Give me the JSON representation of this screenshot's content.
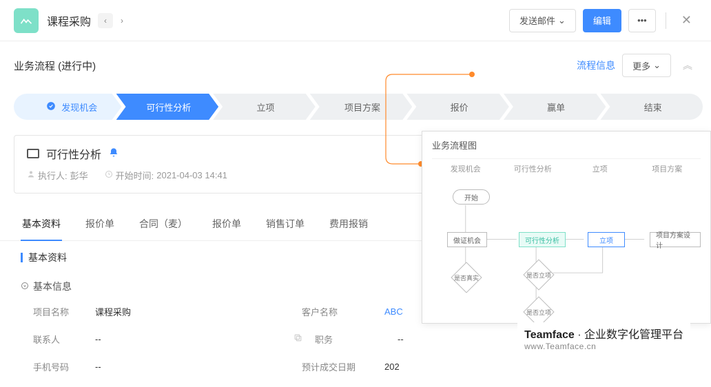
{
  "header": {
    "title": "课程采购",
    "send_mail": "发送邮件",
    "edit": "编辑"
  },
  "process": {
    "title": "业务流程 (进行中)",
    "flow_info": "流程信息",
    "more": "更多",
    "steps": [
      {
        "label": "发现机会"
      },
      {
        "label": "可行性分析"
      },
      {
        "label": "立项"
      },
      {
        "label": "项目方案"
      },
      {
        "label": "报价"
      },
      {
        "label": "赢单"
      },
      {
        "label": "结束"
      }
    ]
  },
  "task": {
    "name": "可行性分析",
    "executor_label": "执行人:",
    "executor": "彭华",
    "start_label": "开始时间:",
    "start_time": "2021-04-03 14:41"
  },
  "tabs": [
    {
      "label": "基本资料"
    },
    {
      "label": "报价单"
    },
    {
      "label": "合同（麦）"
    },
    {
      "label": "报价单"
    },
    {
      "label": "销售订单"
    },
    {
      "label": "费用报销"
    }
  ],
  "section": {
    "heading": "基本资料",
    "subheading": "基本信息"
  },
  "fields": {
    "row1": {
      "l1": "项目名称",
      "v1": "课程采购",
      "l2": "客户名称",
      "v2": "ABC"
    },
    "row2": {
      "l1": "联系人",
      "v1": "--",
      "l2": "职务",
      "v2": "--"
    },
    "row3": {
      "l1": "手机号码",
      "v1": "--",
      "l2": "预计成交日期",
      "v2": "202"
    }
  },
  "flow": {
    "title": "业务流程图",
    "headers": [
      "发现机会",
      "可行性分析",
      "立项",
      "项目方案"
    ],
    "nodes": {
      "start": "开始",
      "n1": "做证机会",
      "n2": "可行性分析",
      "n3": "立项",
      "n4": "项目方案设计",
      "d1": "是否真实",
      "d2": "是否立项",
      "d3": "是否立项"
    }
  },
  "brand": {
    "name": "Teamface",
    "tag": "· 企业数字化管理平台",
    "url": "www.Teamface.cn"
  }
}
